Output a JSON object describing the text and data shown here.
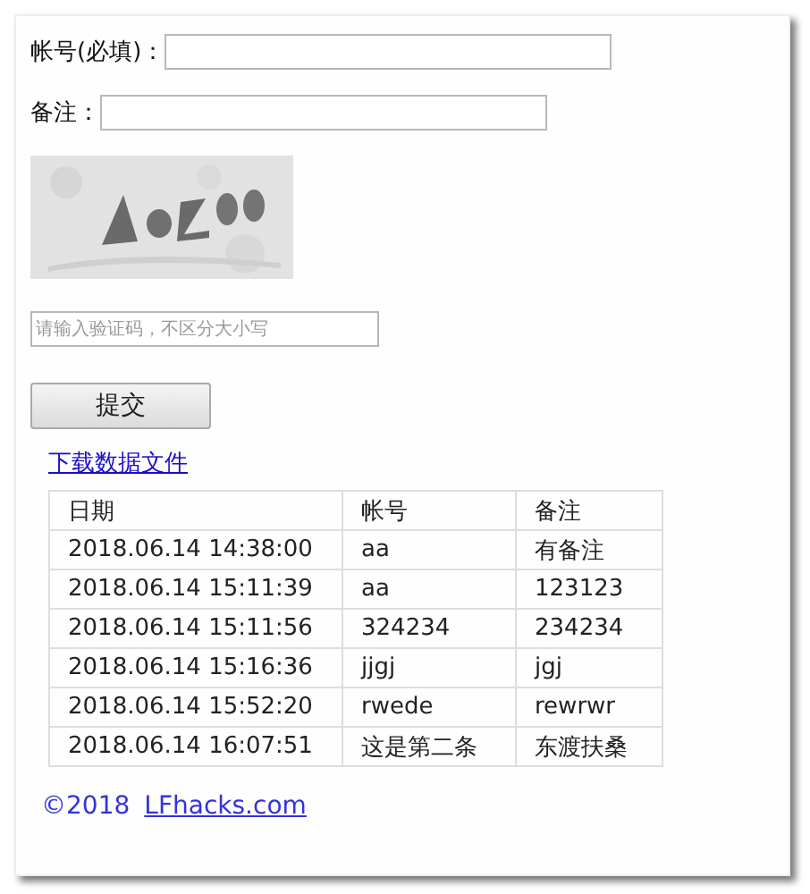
{
  "form": {
    "account_label": "帐号(必填)：",
    "remark_label": "备注：",
    "captcha_field": {
      "placeholder": "请输入验证码，不区分大小写"
    },
    "submit": "提交"
  },
  "download_link": "下载数据文件",
  "table": {
    "columns": [
      "日期",
      "帐号",
      "备注"
    ],
    "rows": [
      [
        "2018.06.14 14:38:00",
        "aa",
        "有备注"
      ],
      [
        "2018.06.14 15:11:39",
        "aa",
        "123123"
      ],
      [
        "2018.06.14 15:11:56",
        "324234",
        "234234"
      ],
      [
        "2018.06.14 15:16:36",
        "jjgj",
        "jgj"
      ],
      [
        "2018.06.14 15:52:20",
        "rwede",
        "rewrwr"
      ],
      [
        "2018.06.14 16:07:51",
        "这是第二条",
        "东渡扶桑"
      ]
    ]
  },
  "footer": {
    "copyright": "©2018",
    "link": "LFhacks.com"
  }
}
